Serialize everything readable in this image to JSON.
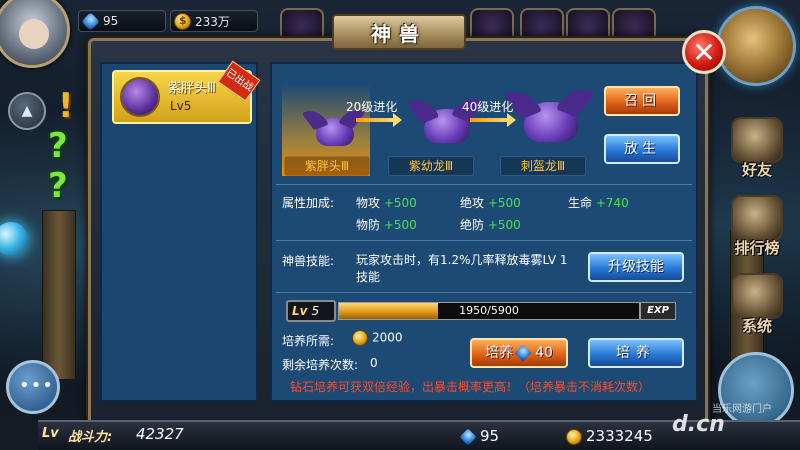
{
  "top": {
    "gems": "95",
    "gold": "233万"
  },
  "panel": {
    "title": "神兽",
    "close_symbol": "✕"
  },
  "pet_list": [
    {
      "name": "紫胖头Ⅲ",
      "level": "Lv5",
      "badge": "已出战"
    }
  ],
  "evolution": {
    "stages": [
      "紫胖头Ⅲ",
      "紫幼龙Ⅲ",
      "刺盔龙Ⅲ"
    ],
    "arrows": [
      "20级进化",
      "40级进化"
    ]
  },
  "buttons": {
    "recall": "召回",
    "release": "放生",
    "upgrade_skill": "升级技能",
    "train_gem_label": "培养",
    "train_gem_cost": "40",
    "train": "培养"
  },
  "attributes": {
    "label": "属性加成:",
    "items": [
      {
        "name": "物攻",
        "value": "+500"
      },
      {
        "name": "绝攻",
        "value": "+500"
      },
      {
        "name": "生命",
        "value": "+740"
      },
      {
        "name": "物防",
        "value": "+500"
      },
      {
        "name": "绝防",
        "value": "+500"
      }
    ]
  },
  "skill": {
    "label": "神兽技能:",
    "desc": "玩家攻击时，有1.2%几率释放毒雾LV 1技能"
  },
  "level_bar": {
    "lv_prefix": "Lv",
    "level": "5",
    "current": 1950,
    "max": 5900,
    "text": "1950/5900",
    "exp_tag": "EXP"
  },
  "training": {
    "cost_label": "培养所需:",
    "cost": "2000",
    "remaining_label": "剩余培养次数:",
    "remaining": "0",
    "notice": "钻石培养可获双倍经验，出暴击概率更高！（培养暴击不消耗次数）"
  },
  "side_menu": [
    "好友",
    "排行榜",
    "系统"
  ],
  "bottom": {
    "lv_tag": "Lv",
    "power_label": "战斗力:",
    "power": "42327",
    "gems": "95",
    "gold": "2333245"
  },
  "watermark": {
    "text": "d.cn",
    "sub": "当乐网游门户"
  }
}
